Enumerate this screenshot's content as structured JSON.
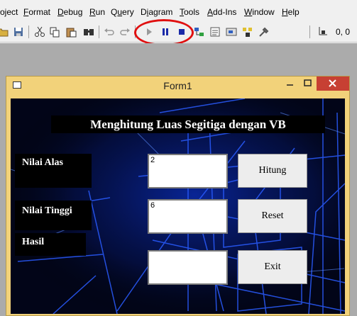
{
  "menubar": {
    "items": [
      {
        "label": "oject"
      },
      {
        "pre": "",
        "u": "F",
        "post": "ormat"
      },
      {
        "pre": "",
        "u": "D",
        "post": "ebug"
      },
      {
        "pre": "",
        "u": "R",
        "post": "un"
      },
      {
        "pre": "Q",
        "u": "u",
        "post": "ery"
      },
      {
        "pre": "D",
        "u": "i",
        "post": "agram"
      },
      {
        "pre": "",
        "u": "T",
        "post": "ools"
      },
      {
        "pre": "",
        "u": "A",
        "post": "dd-Ins"
      },
      {
        "pre": "",
        "u": "W",
        "post": "indow"
      },
      {
        "pre": "",
        "u": "H",
        "post": "elp"
      }
    ]
  },
  "toolbar": {
    "icons": [
      "open-icon",
      "save-icon",
      "cut-icon",
      "copy-icon",
      "paste-icon",
      "find-icon",
      "undo-icon",
      "redo-icon",
      "start-icon",
      "break-icon",
      "end-icon",
      "project-explorer-icon",
      "properties-icon",
      "form-layout-icon",
      "object-browser-icon",
      "toolbox-icon",
      "position-icon"
    ],
    "coordinates": "0, 0"
  },
  "form": {
    "title": "Form1",
    "heading": "Menghitung Luas Segitiga dengan VB",
    "label_alas": "Nilai Alas",
    "label_tinggi": "Nilai Tinggi",
    "label_hasil": "Hasil",
    "value_alas": "2",
    "value_tinggi": "6",
    "value_hasil": "",
    "button_hitung": "Hitung",
    "button_reset": "Reset",
    "button_exit": "Exit"
  },
  "colors": {
    "titlebar": "#f2d27a",
    "close_button": "#c74033",
    "highlight_ellipse": "#e01010",
    "background_grid": "#1a4cff"
  }
}
